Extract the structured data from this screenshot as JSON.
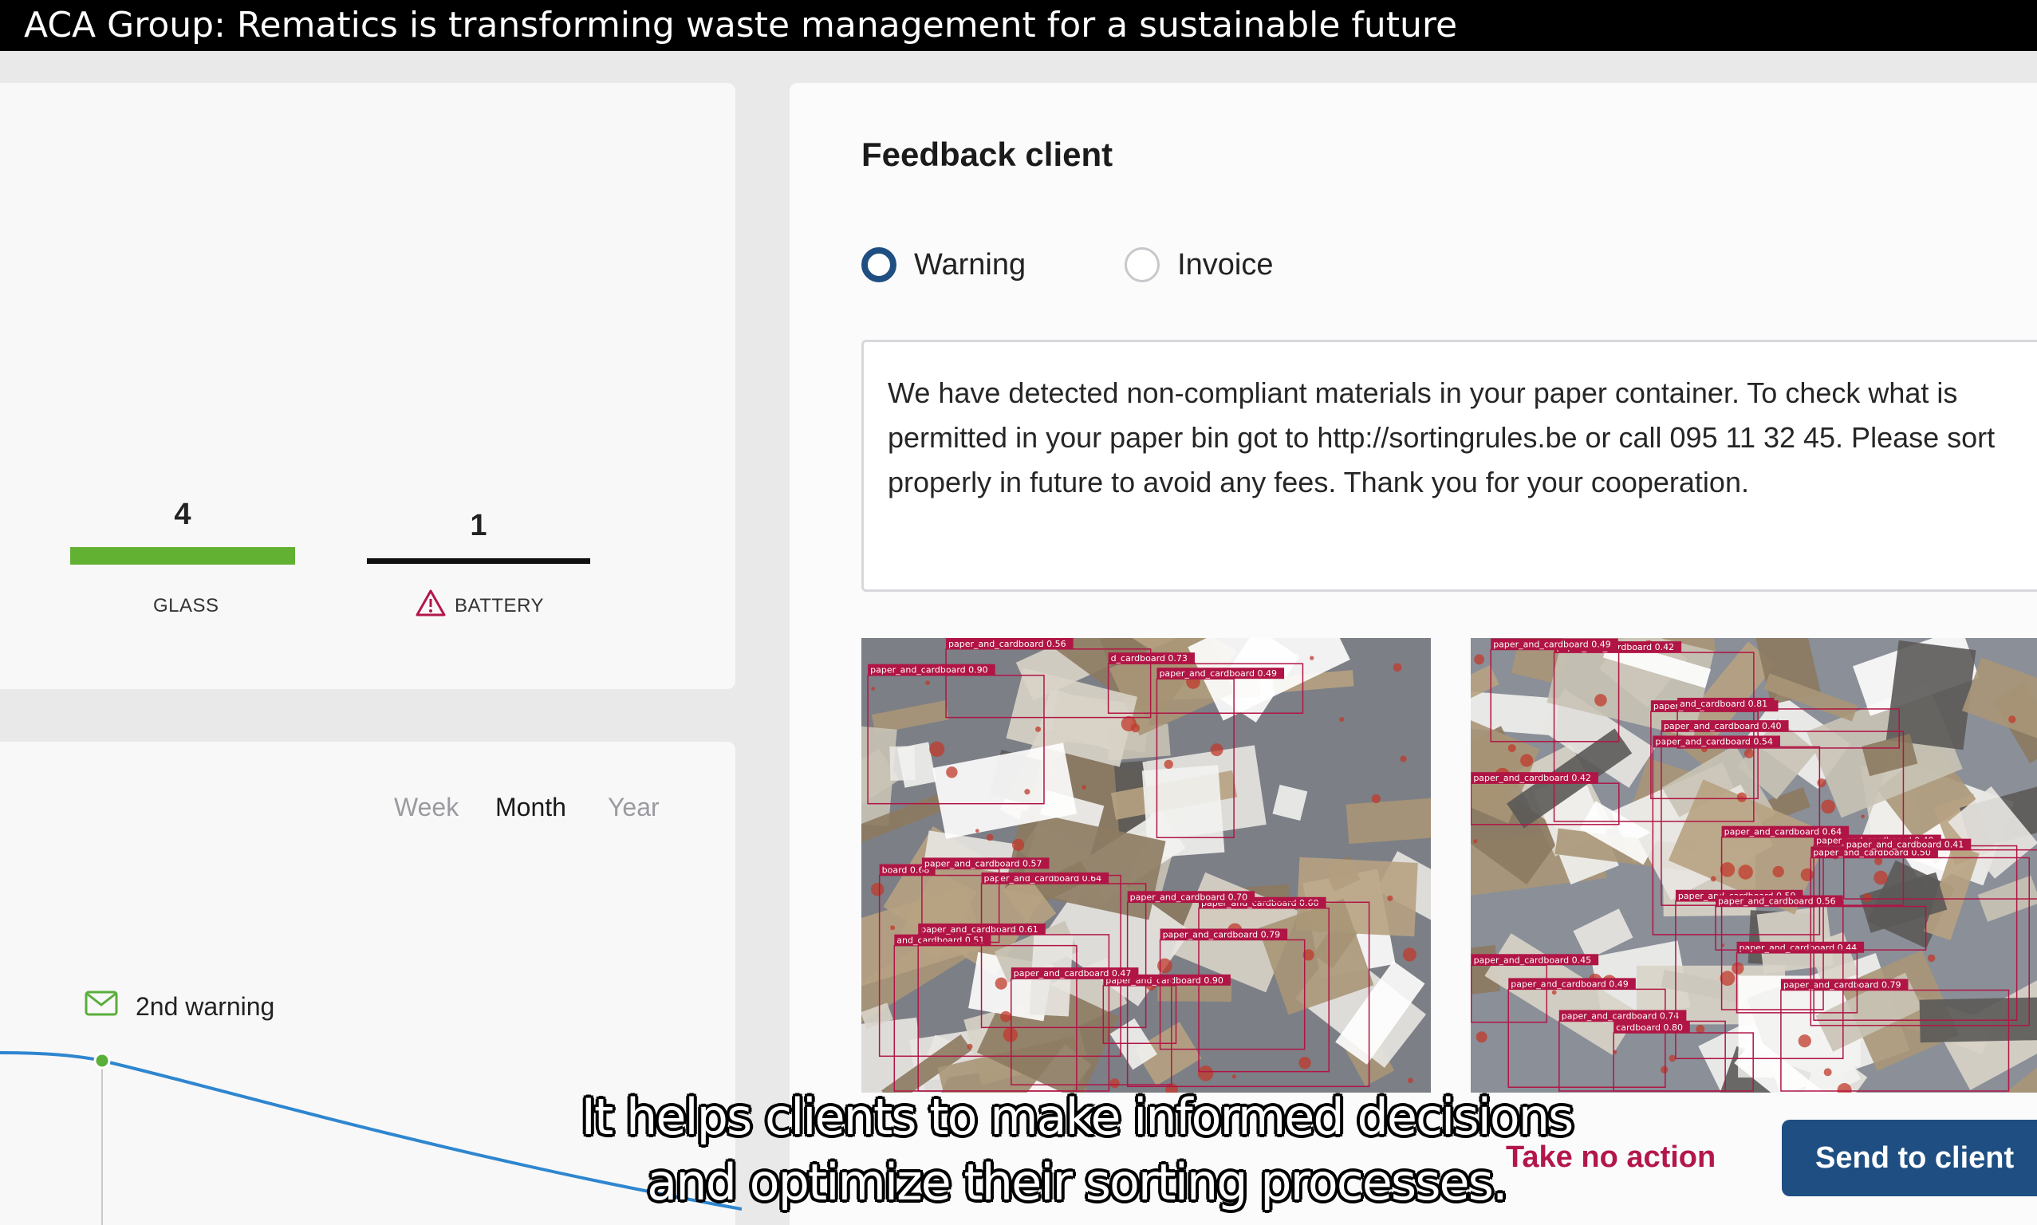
{
  "video": {
    "title": "ACA Group: Rematics is transforming waste management for a sustainable future"
  },
  "stats": [
    {
      "label": "GLASS",
      "value": "4",
      "bar_color": "#62b133"
    },
    {
      "label": "BATTERY",
      "value": "1",
      "bar_color": "#111111",
      "icon": "warning-triangle-icon",
      "icon_color": "#b3174a"
    }
  ],
  "periods": {
    "week": "Week",
    "month": "Month",
    "year": "Year",
    "selected": "Month"
  },
  "timeline": {
    "event_label": "2nd warning",
    "event_icon": "mail-icon",
    "line_color": "#2e86cf",
    "marker_color": "#5aae3a"
  },
  "feedback": {
    "title": "Feedback client",
    "options": [
      {
        "label": "Warning",
        "checked": true
      },
      {
        "label": "Invoice",
        "checked": false
      }
    ],
    "message": "We have detected non-compliant materials in your paper container. To check what is permitted in your paper bin got to http://sortingrules.be or call 095 11 32 45. Please sort properly in future to avoid any fees. Thank you for your cooperation.",
    "detections_left": [
      "paper_and_cardboard 0.90",
      "paper_and_cardboard 0.61",
      "paper_and_cardboard 0.64",
      "paper_and_cardboard 0.60",
      "paper_and_cardboard 0.70",
      "board 0.68",
      "paper_and_cardboard 0.56",
      "paper_and_cardboard 0.90",
      "paper_and_cardboard 0.49",
      "paper_and_cardboard 0.79",
      "d_cardboard 0.73",
      "and_cardboard 0.51",
      "paper_and_cardboard 0.57",
      "paper_and_cardboard 0.47"
    ],
    "detections_right": [
      "paper_and_cardboard 0.67",
      "paper_and_cardboard 0.42",
      "paper_and_cardboard 0.74",
      "paper_and_cardboard 0.59",
      "paper_and_cardboard 0.64",
      "and_cardboard 0.81",
      "paper_and_cardboard 0.49",
      "paper_and_cardboard 0.54",
      "paper_and_cardboard 0.79",
      "paper_and_cardboard 0.49",
      "cardboard 0.80",
      "paper_and_cardboard 0.44",
      "paper_and_cardboard 0.40",
      "paper_and_cardboard 0.42",
      "paper_and_cardboard 0.50",
      "paper_and_cardboard 0.56",
      "paper_and_cardboard 0.49",
      "paper_and_cardboard 0.45",
      "paper_and_cardboard 0.41"
    ],
    "take_no_action": "Take no action",
    "send": "Send to client"
  },
  "subtitle": {
    "line1": "It helps clients to make informed decisions",
    "line2": "and optimize their sorting processes."
  }
}
